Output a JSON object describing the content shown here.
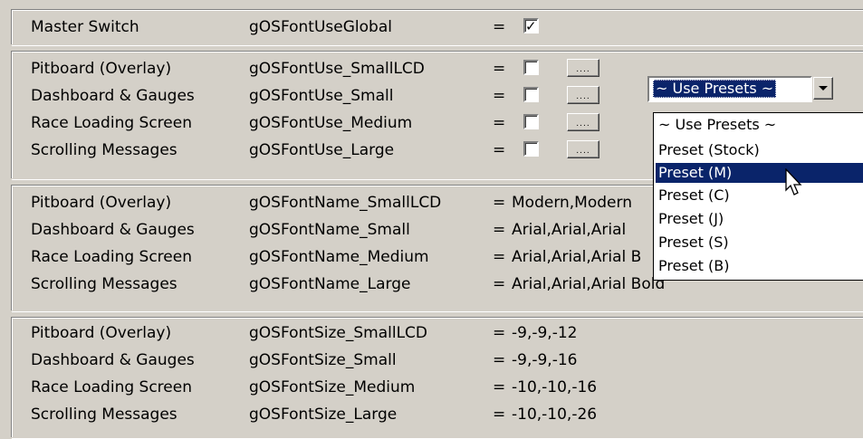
{
  "master": {
    "label": "Master Switch",
    "key": "gOSFontUseGlobal",
    "eq": "=",
    "checked": true,
    "check_glyph": "✓"
  },
  "font_use": [
    {
      "label": "Pitboard (Overlay)",
      "key": "gOSFontUse_SmallLCD",
      "eq": "=",
      "checked": false,
      "button": "...."
    },
    {
      "label": "Dashboard & Gauges",
      "key": "gOSFontUse_Small",
      "eq": "=",
      "checked": false,
      "button": "...."
    },
    {
      "label": "Race Loading Screen",
      "key": "gOSFontUse_Medium",
      "eq": "=",
      "checked": false,
      "button": "...."
    },
    {
      "label": "Scrolling Messages",
      "key": "gOSFontUse_Large",
      "eq": "=",
      "checked": false,
      "button": "...."
    }
  ],
  "font_name": [
    {
      "label": "Pitboard (Overlay)",
      "key": "gOSFontName_SmallLCD",
      "eq": "=",
      "value": "Modern,Modern"
    },
    {
      "label": "Dashboard & Gauges",
      "key": "gOSFontName_Small",
      "eq": "=",
      "value": "Arial,Arial,Arial"
    },
    {
      "label": "Race Loading Screen",
      "key": "gOSFontName_Medium",
      "eq": "=",
      "value": "Arial,Arial,Arial B"
    },
    {
      "label": "Scrolling Messages",
      "key": "gOSFontName_Large",
      "eq": "=",
      "value": "Arial,Arial,Arial Bold"
    }
  ],
  "font_size": [
    {
      "label": "Pitboard (Overlay)",
      "key": "gOSFontSize_SmallLCD",
      "eq": "=",
      "value": "-9,-9,-12"
    },
    {
      "label": "Dashboard & Gauges",
      "key": "gOSFontSize_Small",
      "eq": "=",
      "value": "-9,-9,-16"
    },
    {
      "label": "Race Loading Screen",
      "key": "gOSFontSize_Medium",
      "eq": "=",
      "value": "-10,-10,-16"
    },
    {
      "label": "Scrolling Messages",
      "key": "gOSFontSize_Large",
      "eq": "=",
      "value": "-10,-10,-26"
    }
  ],
  "presets_combo": {
    "selected": "~ Use Presets ~",
    "options": [
      "~ Use Presets ~",
      "Preset (Stock)",
      "Preset (M)",
      "Preset (C)",
      "Preset (J)",
      "Preset (S)",
      "Preset (B)"
    ],
    "highlighted": "Preset (M)"
  },
  "colors": {
    "face": "#d4d0c8",
    "highlight": "#0a246a",
    "window": "#ffffff"
  }
}
